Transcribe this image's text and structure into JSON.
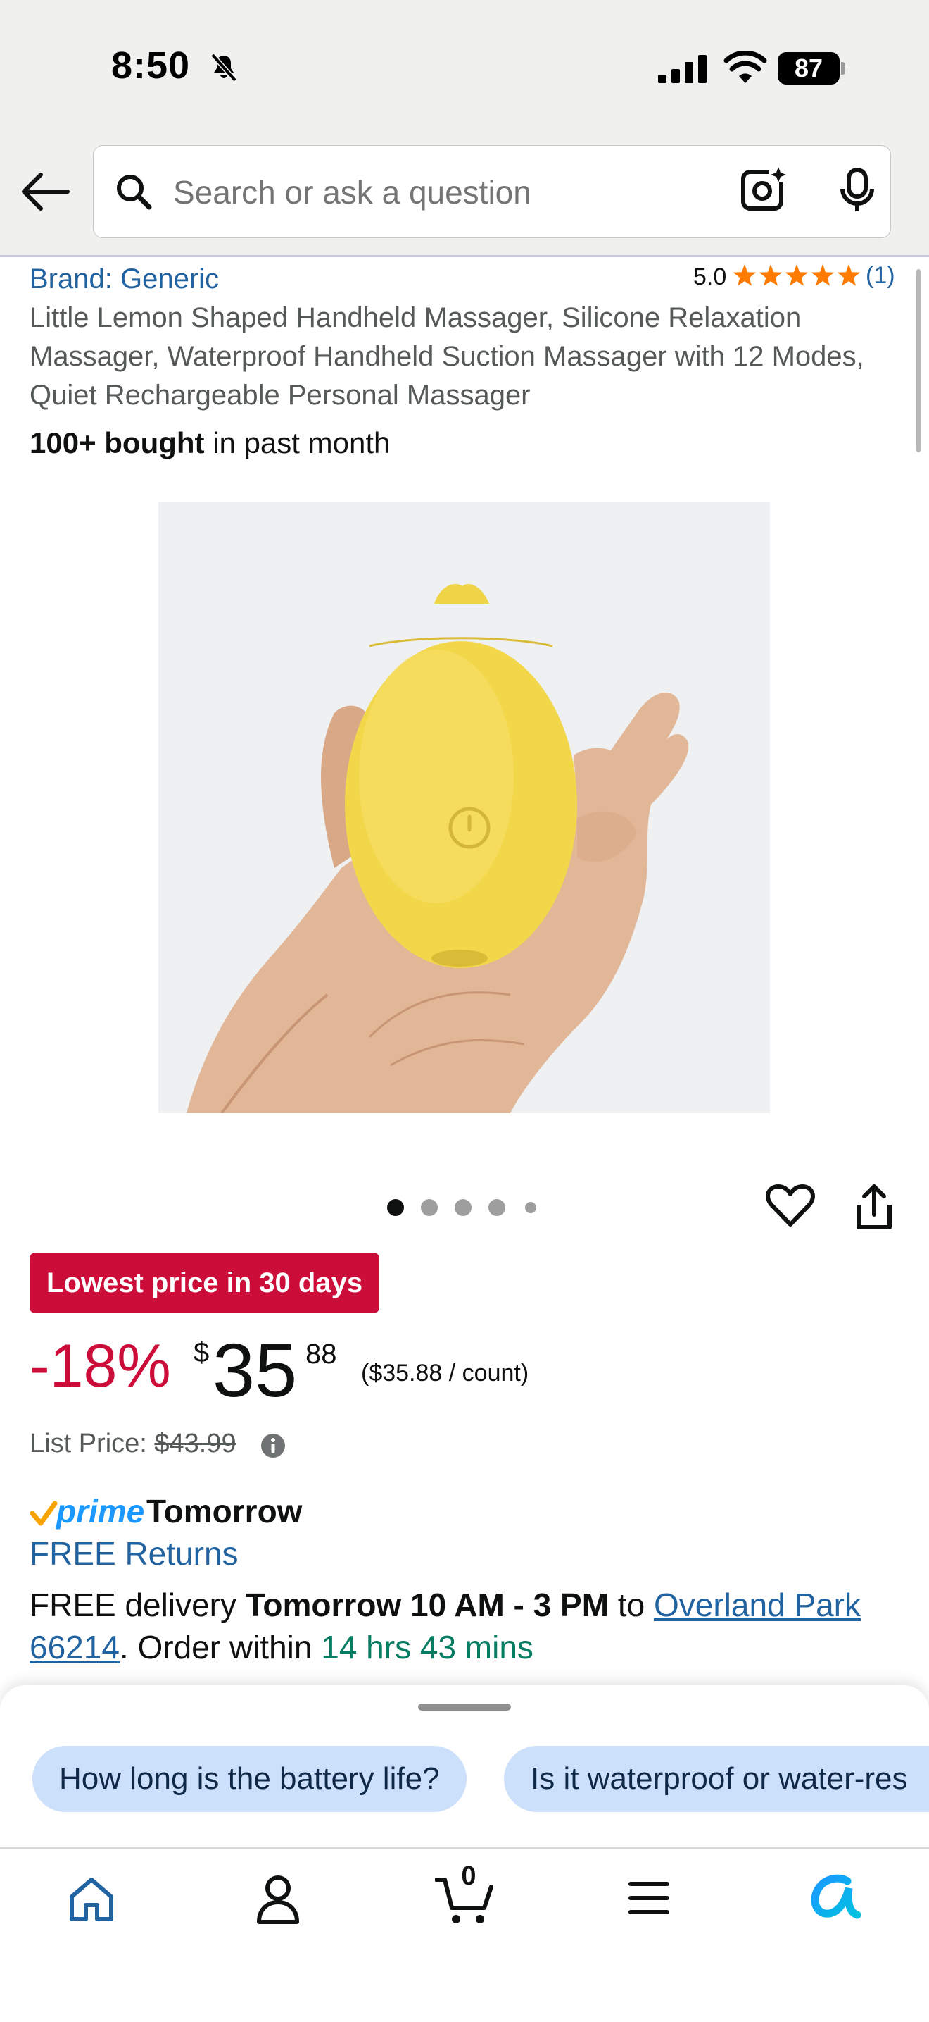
{
  "status_bar": {
    "time": "8:50",
    "battery": "87"
  },
  "search": {
    "placeholder": "Search or ask a question"
  },
  "product": {
    "brand": "Brand: Generic",
    "rating": "5.0",
    "rating_count": "(1)",
    "stars": 5,
    "title": "Little Lemon Shaped Handheld Massager, Silicone Relaxation Massager, Waterproof Handheld Suction Massager with 12 Modes, Quiet Rechargeable Personal Massager",
    "bought_bold": "100+ bought",
    "bought_rest": " in past month",
    "image_count": 5,
    "image_active_index": 0
  },
  "price": {
    "badge": "Lowest price in 30 days",
    "discount": "-18%",
    "currency": "$",
    "whole": "35",
    "fraction": "88",
    "unit_price": "($35.88 / count)",
    "list_label": "List Price: ",
    "list_value": "$43.99"
  },
  "delivery": {
    "prime_word": "prime",
    "prime_when": "Tomorrow",
    "free_returns": "FREE Returns",
    "line_a": "FREE delivery ",
    "line_b": "Tomorrow 10 AM - 3 PM",
    "line_c": " to ",
    "location": "Overland Park 66214",
    "line_d": ". Order within ",
    "countdown": "14 hrs 43 mins"
  },
  "suggestions": [
    "How long is the battery life?",
    "Is it waterproof or water-res"
  ],
  "nav": {
    "cart_count": "0"
  },
  "colors": {
    "link": "#2162a1",
    "deal_red": "#cc0c39",
    "prime_blue": "#1a98ff",
    "star_orange": "#ff7a00",
    "chip_blue": "#cce0fb",
    "green": "#067d62"
  }
}
